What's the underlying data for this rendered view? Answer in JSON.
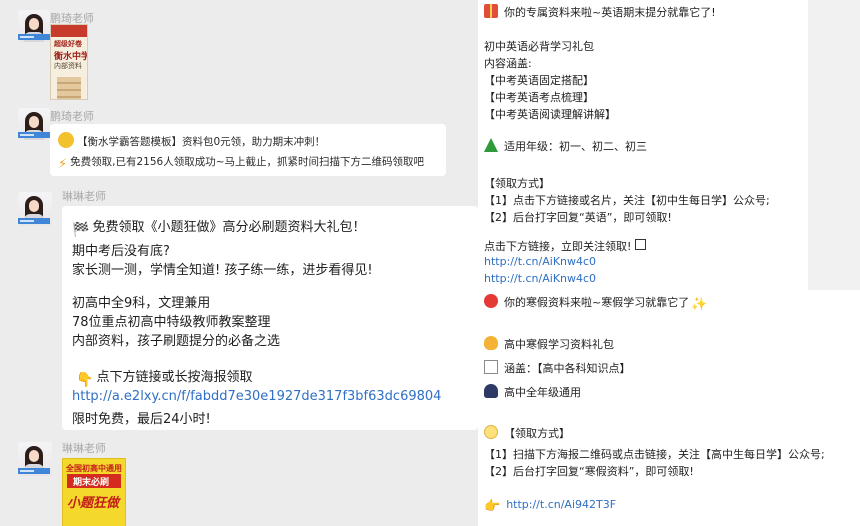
{
  "left_chat": {
    "messages": [
      {
        "sender": "鹏琦老师",
        "type": "poster",
        "poster": {
          "line1": "超级好卷",
          "line2": "衡水中学",
          "line3": "内部资料"
        }
      },
      {
        "sender": "鹏琦老师",
        "type": "text",
        "lines": [
          {
            "icon": "smile-face-icon",
            "text": "【衡水学霸答题模板】资料包0元领，助力期末冲刺！"
          },
          {
            "icon": "lightning-icon",
            "text": "免费领取,已有2156人领取成功~马上截止，抓紧时间扫描下方二维码领取吧"
          }
        ]
      },
      {
        "sender": "琳琳老师",
        "type": "text",
        "title": "免费领取《小题狂做》高分必刷题资料大礼包！",
        "lines": [
          "期中考后没有底?",
          "家长测一测，学情全知道! 孩子练一练，进步看得见!",
          "初高中全9科，文理兼用",
          "78位重点初高中特级教师教案整理",
          "内部资料，孩子刷题提分的必备之选"
        ],
        "cta": "点下方链接或长按海报领取",
        "link": "http://a.e2lxy.cn/f/fabdd7e30e1927de317f3bf63dc69804",
        "footer": "限时免费，最后24小时!"
      },
      {
        "sender": "琳琳老师",
        "type": "poster",
        "poster": {
          "line1": "全国初高中通用",
          "line2": "期末必刷",
          "line3": "小题狂做"
        }
      }
    ]
  },
  "right_panel": {
    "block1": {
      "headline": "你的专属资料来啦~英语期末提分就靠它了!",
      "pack_title": "初中英语必背学习礼包",
      "contents_label": "内容涵盖:",
      "contents": [
        "【中考英语固定搭配】",
        "【中考英语考点梳理】",
        "【中考英语阅读理解讲解】"
      ],
      "grades": "适用年级：初一、初二、初三",
      "method_title": "【领取方式】",
      "steps": [
        "【1】点击下方链接或名片，关注【初中生每日学】公众号;",
        "【2】后台打字回复“英语”，即可领取!"
      ],
      "follow": "点击下方链接，立即关注领取!",
      "links": [
        "http://t.cn/AiKnw4c0",
        "http://t.cn/AiKnw4c0"
      ]
    },
    "block2": {
      "headline": "你的寒假资料来啦~寒假学习就靠它了",
      "pack_title": "高中寒假学习资料礼包",
      "contents": "涵盖：【高中各科知识点】",
      "grades": "高中全年级通用",
      "method_title": "【领取方式】",
      "steps": [
        "【1】扫描下方海报二维码或点击链接，关注【高中生每日学】公众号;",
        "【2】后台打字回复“寒假资料”，即可领取!"
      ],
      "link": "http://t.cn/Ai942T3F"
    }
  }
}
